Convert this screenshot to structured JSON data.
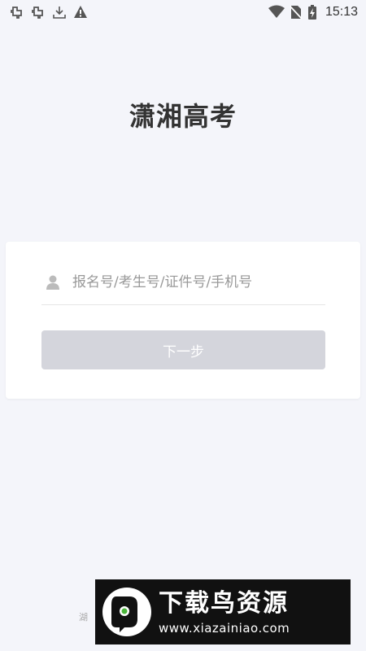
{
  "status_bar": {
    "time": "15:13",
    "left_icons": [
      "bug-icon",
      "bug-icon",
      "download-icon",
      "warning-icon"
    ],
    "right_icons": [
      "wifi-icon",
      "no-sim-icon",
      "battery-charging-icon"
    ]
  },
  "app": {
    "title": "潇湘高考"
  },
  "login": {
    "account_placeholder": "报名号/考生号/证件号/手机号",
    "account_value": "",
    "next_label": "下一步",
    "user_icon": "user-icon"
  },
  "footer": {
    "text": "湖"
  },
  "watermark": {
    "title": "下载鸟资源",
    "url": "www.xiazainiao.com"
  },
  "colors": {
    "background": "#f4f5fa",
    "card": "#ffffff",
    "button_disabled": "#d4d5dc",
    "title_text": "#333333",
    "watermark_bg": "#111111"
  }
}
